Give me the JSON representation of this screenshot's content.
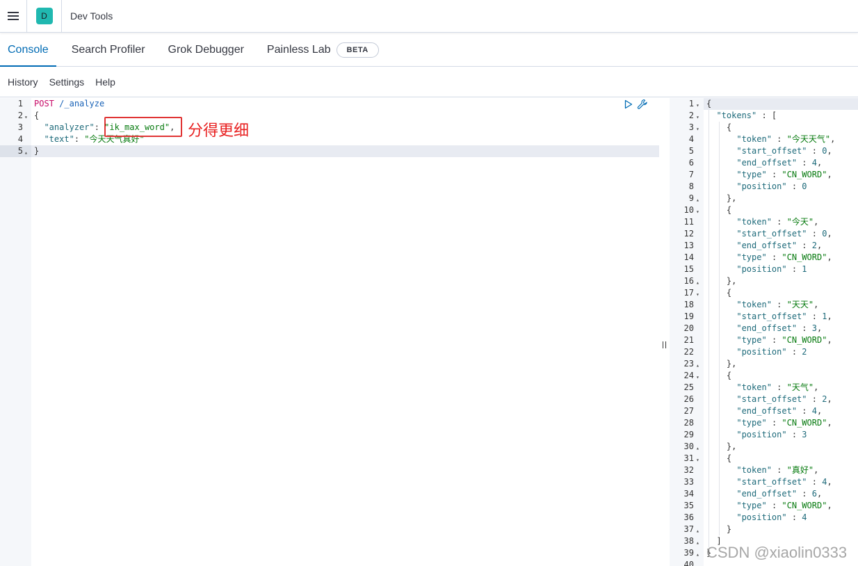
{
  "header": {
    "space_initial": "D",
    "app_title": "Dev Tools"
  },
  "tabs": [
    {
      "label": "Console",
      "active": true
    },
    {
      "label": "Search Profiler",
      "active": false
    },
    {
      "label": "Grok Debugger",
      "active": false
    },
    {
      "label": "Painless Lab",
      "active": false,
      "badge": "BETA"
    }
  ],
  "submenu": {
    "history": "History",
    "settings": "Settings",
    "help": "Help"
  },
  "request": {
    "lines": [
      {
        "n": "1",
        "fold": ""
      },
      {
        "n": "2",
        "fold": "▾"
      },
      {
        "n": "3",
        "fold": ""
      },
      {
        "n": "4",
        "fold": ""
      },
      {
        "n": "5",
        "fold": "▴"
      }
    ],
    "method": "POST",
    "path": "/_analyze",
    "open_brace": "{",
    "analyzer_key": "\"analyzer\"",
    "analyzer_val": "\"ik_max_word\"",
    "text_key": "\"text\"",
    "text_val": "\"今天天气真好\"",
    "close_brace": "}"
  },
  "annotation": "分得更细",
  "response": {
    "folds": {
      "1": "▾",
      "2": "▾",
      "3": "▾",
      "9": "▴",
      "10": "▾",
      "16": "▴",
      "17": "▾",
      "23": "▴",
      "24": "▾",
      "30": "▴",
      "31": "▾",
      "37": "▴",
      "38": "▴",
      "39": "▴"
    },
    "tokens_key": "\"tokens\"",
    "tokens": [
      {
        "token": "\"今天天气\"",
        "start_offset": "0",
        "end_offset": "4",
        "type": "\"CN_WORD\"",
        "position": "0"
      },
      {
        "token": "\"今天\"",
        "start_offset": "0",
        "end_offset": "2",
        "type": "\"CN_WORD\"",
        "position": "1"
      },
      {
        "token": "\"天天\"",
        "start_offset": "1",
        "end_offset": "3",
        "type": "\"CN_WORD\"",
        "position": "2"
      },
      {
        "token": "\"天气\"",
        "start_offset": "2",
        "end_offset": "4",
        "type": "\"CN_WORD\"",
        "position": "3"
      },
      {
        "token": "\"真好\"",
        "start_offset": "4",
        "end_offset": "6",
        "type": "\"CN_WORD\"",
        "position": "4"
      }
    ],
    "total_lines": 40
  },
  "watermark": "CSDN @xiaolin0333",
  "icons": {
    "menu": "hamburger-icon",
    "run": "play-icon",
    "settings": "wrench-icon",
    "resize": "resize-grip-icon"
  }
}
